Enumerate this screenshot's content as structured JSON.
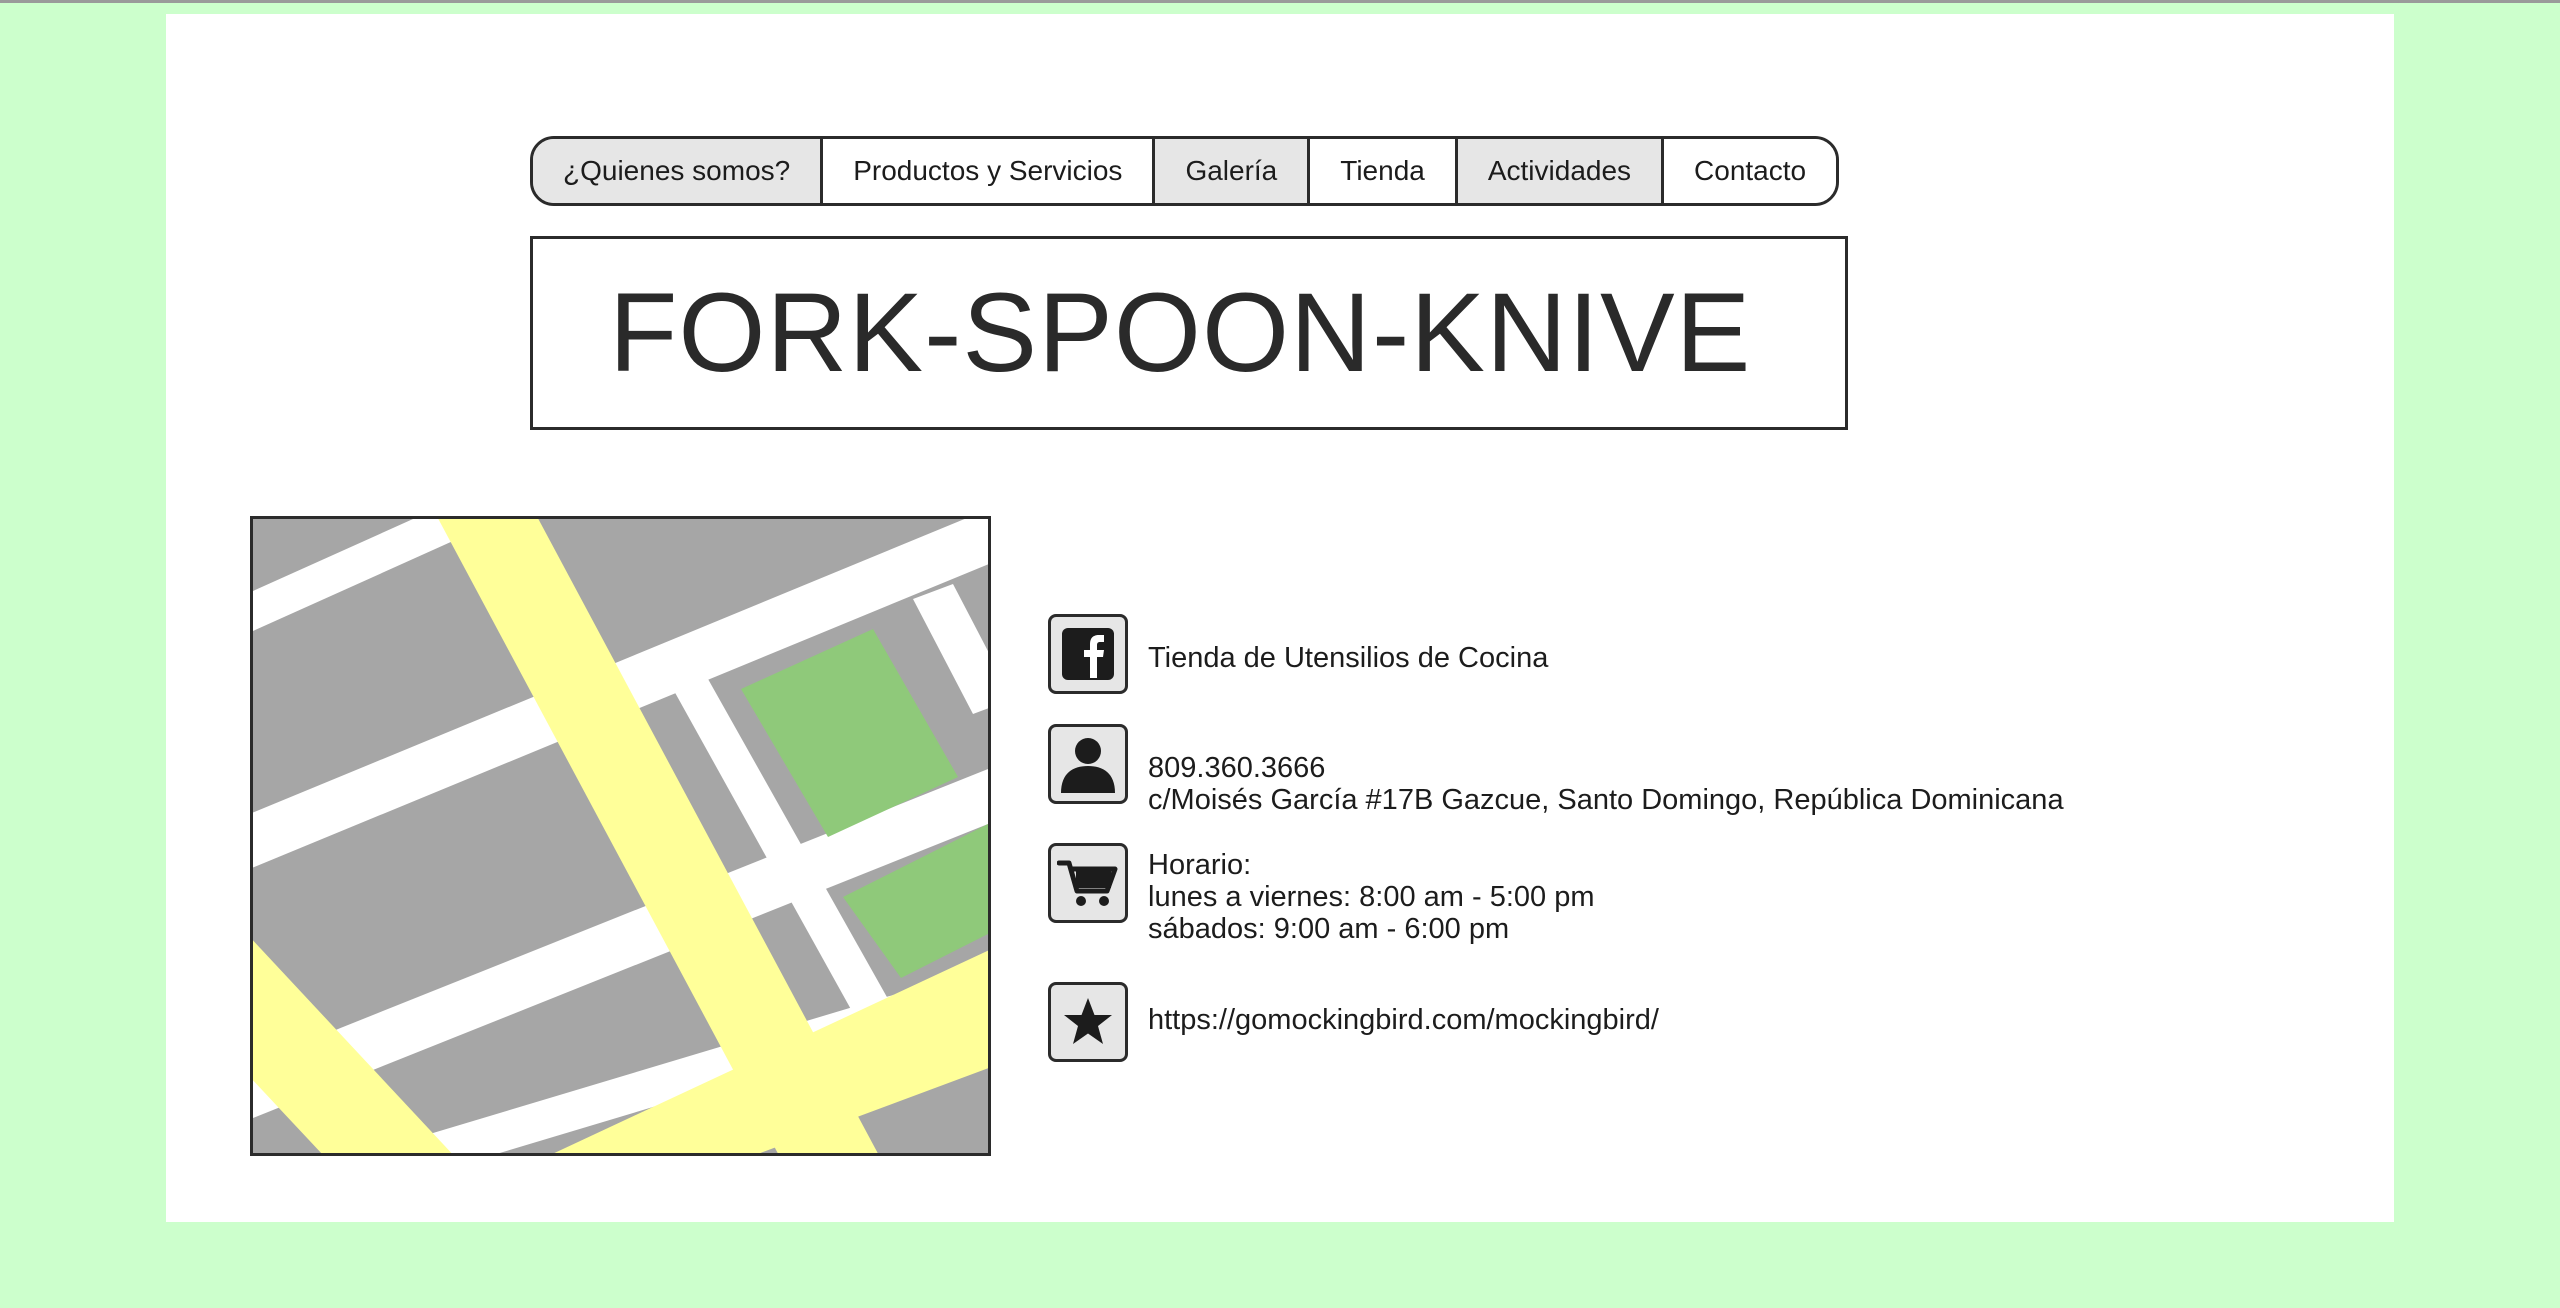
{
  "nav": {
    "items": [
      {
        "label": "¿Quienes somos?"
      },
      {
        "label": "Productos y Servicios"
      },
      {
        "label": "Galería"
      },
      {
        "label": "Tienda"
      },
      {
        "label": "Actividades"
      },
      {
        "label": "Contacto"
      }
    ]
  },
  "header": {
    "title": "FORK-SPOON-KNIVE"
  },
  "map": {
    "icon": "map-image"
  },
  "contact": {
    "facebook": {
      "icon": "facebook-icon",
      "text": "Tienda de Utensilios de Cocina"
    },
    "person": {
      "icon": "person-icon",
      "phone": "809.360.3666",
      "address": "c/Moisés García #17B Gazcue, Santo Domingo, República Dominicana"
    },
    "schedule": {
      "icon": "shopping-cart-icon",
      "heading": "Horario:",
      "weekdays": "lunes a viernes: 8:00 am - 5:00 pm",
      "saturday": "sábados: 9:00 am - 6:00 pm"
    },
    "website": {
      "icon": "star-icon",
      "url": "https://gomockingbird.com/mockingbird/"
    }
  },
  "colors": {
    "background": "#ccffcc",
    "page": "#ffffff",
    "nav_shaded": "#e6e6e6",
    "map_block": "#a6a6a6",
    "map_road": "#ffff99",
    "map_park": "#8fc97a",
    "border": "#2b2b2b"
  }
}
